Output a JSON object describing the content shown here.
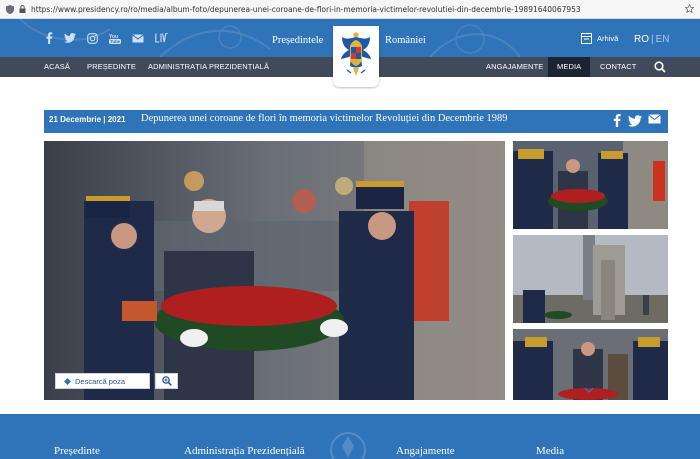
{
  "browser": {
    "url": "https://www.presidency.ro/ro/media/album-foto/depunerea-unei-coroane-de-flori-in-memoria-victimelor-revolutiei-din-decembrie-19891640067953"
  },
  "header": {
    "brand_left": "Președintele",
    "brand_right": "României",
    "archive_label": "Arhivă",
    "lang_ro": "RO",
    "lang_sep": "|",
    "lang_en": "EN",
    "social_icons": [
      "facebook-icon",
      "twitter-icon",
      "instagram-icon",
      "youtube-icon",
      "email-icon",
      "live-icon"
    ]
  },
  "nav": {
    "items": [
      "ACASĂ",
      "PREȘEDINTE",
      "ADMINISTRAȚIA PREZIDENȚIALĂ",
      "ANGAJAMENTE",
      "MEDIA",
      "CONTACT"
    ],
    "active": "MEDIA"
  },
  "article": {
    "date": "21 Decembrie | 2021",
    "title": "Depunerea unei coroane de flori în memoria victimelor Revoluției din Decembrie 1989"
  },
  "gallery": {
    "download_label": "Descarcă poza"
  },
  "footer": {
    "items": [
      "Președinte",
      "Administrația Prezidențială",
      "Angajamente",
      "Media"
    ]
  },
  "colors": {
    "brand_blue": "#2f73b8",
    "nav_dark": "#404a5a",
    "nav_active": "#1c2431"
  }
}
